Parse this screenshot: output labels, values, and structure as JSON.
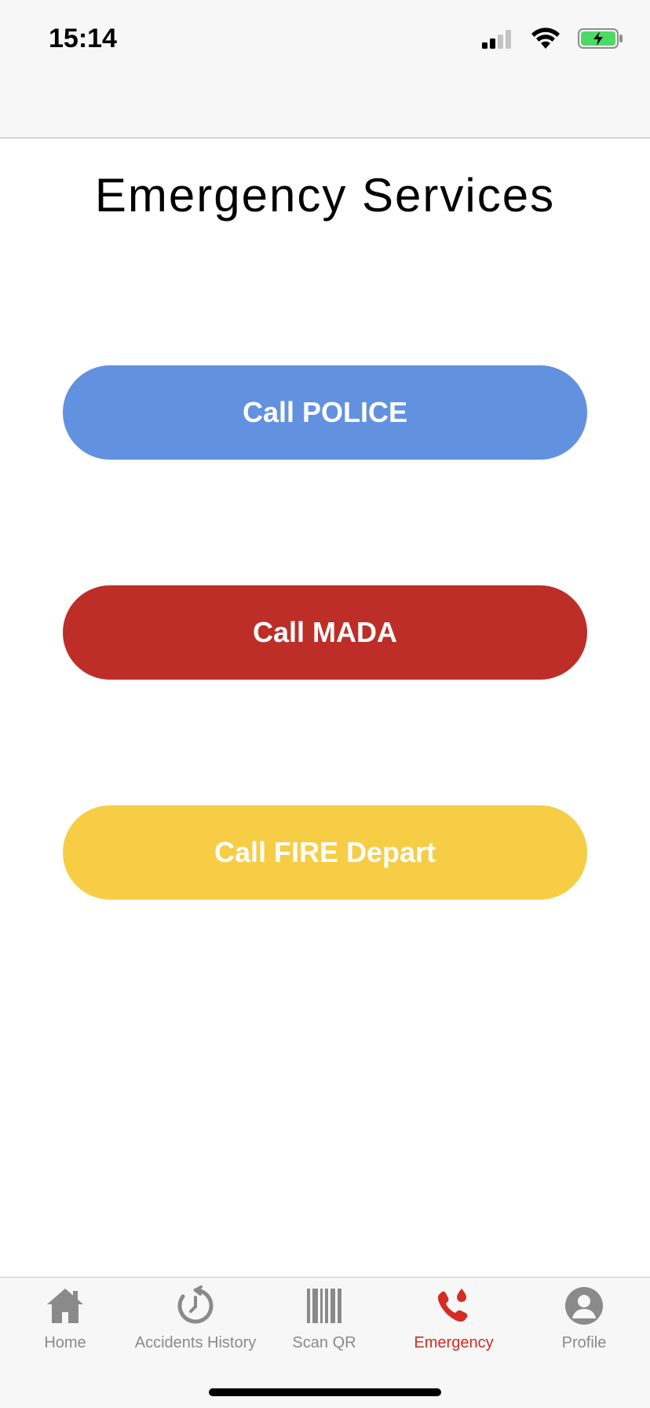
{
  "status_bar": {
    "time": "15:14",
    "icons": [
      "signal-icon",
      "wifi-icon",
      "battery-charging-icon"
    ]
  },
  "page": {
    "title": "Emergency Services"
  },
  "buttons": {
    "police": {
      "label": "Call POLICE",
      "color": "#6291e0"
    },
    "mada": {
      "label": "Call MADA",
      "color": "#bd2e28"
    },
    "fire": {
      "label": "Call FIRE Depart",
      "color": "#f7cd45"
    }
  },
  "tab_bar": {
    "active_color": "#d42b22",
    "inactive_color": "#8a8a8a",
    "items": [
      {
        "label": "Home",
        "icon": "home-icon"
      },
      {
        "label": "Accidents History",
        "icon": "clock-history-icon"
      },
      {
        "label": "Scan QR",
        "icon": "barcode-icon"
      },
      {
        "label": "Emergency",
        "icon": "emergency-phone-icon",
        "active": true
      },
      {
        "label": "Profile",
        "icon": "profile-icon"
      }
    ]
  }
}
